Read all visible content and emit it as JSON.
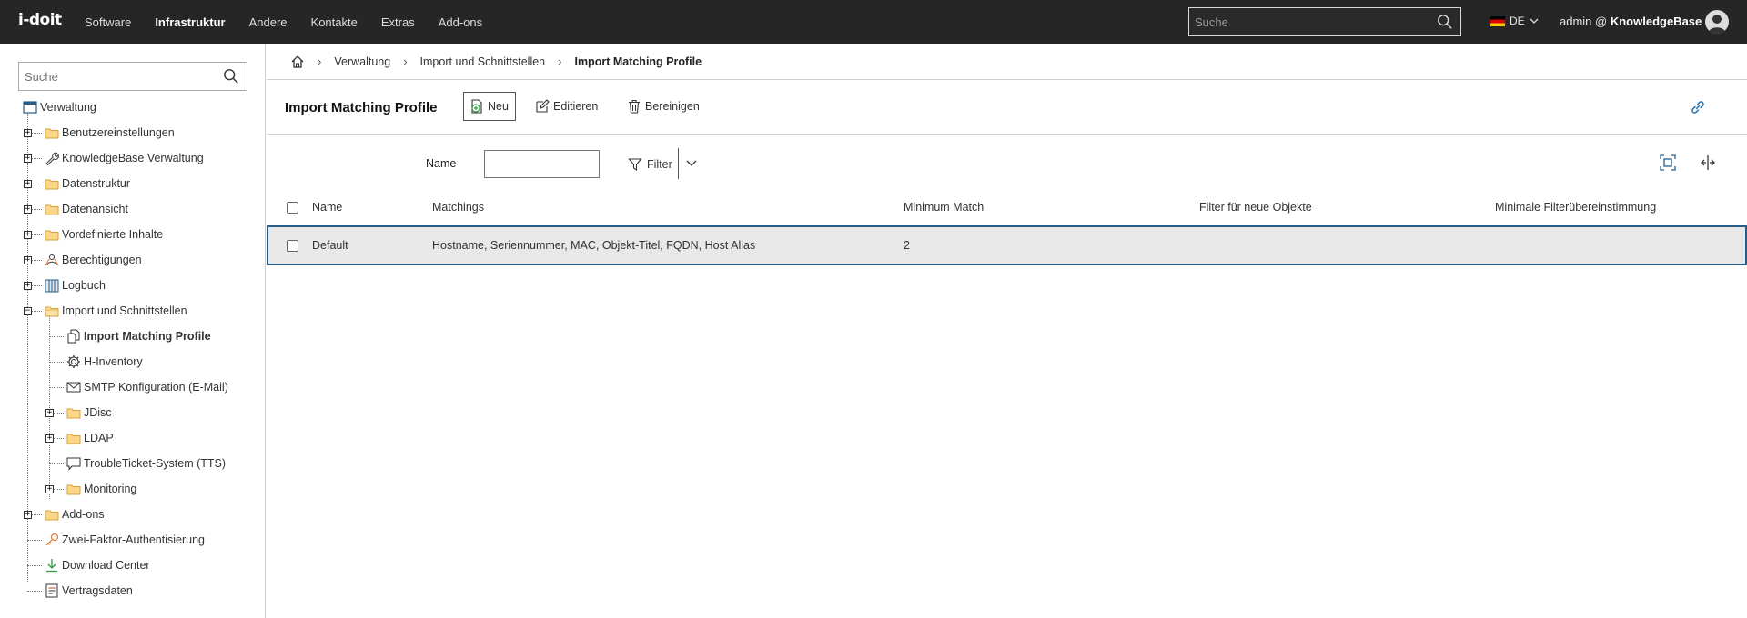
{
  "topbar": {
    "logo": "i-doit",
    "nav": [
      "Software",
      "Infrastruktur",
      "Andere",
      "Kontakte",
      "Extras",
      "Add-ons"
    ],
    "active_nav": "Infrastruktur",
    "search_placeholder": "Suche",
    "language": "DE",
    "user_prefix": "admin @",
    "tenant": "KnowledgeBase"
  },
  "sidebar": {
    "search_placeholder": "Suche",
    "root": "Verwaltung",
    "items": [
      {
        "label": "Benutzereinstellungen",
        "icon": "folder-icon"
      },
      {
        "label": "KnowledgeBase Verwaltung",
        "icon": "wrench-icon"
      },
      {
        "label": "Datenstruktur",
        "icon": "folder-icon"
      },
      {
        "label": "Datenansicht",
        "icon": "folder-icon"
      },
      {
        "label": "Vordefinierte Inhalte",
        "icon": "folder-icon"
      },
      {
        "label": "Berechtigungen",
        "icon": "users-icon"
      },
      {
        "label": "Logbuch",
        "icon": "book-icon"
      },
      {
        "label": "Import und Schnittstellen",
        "icon": "folder-open-icon"
      },
      {
        "label": "Import Matching Profile",
        "icon": "files-icon"
      },
      {
        "label": "H-Inventory",
        "icon": "gear-icon"
      },
      {
        "label": "SMTP Konfiguration (E-Mail)",
        "icon": "mail-icon"
      },
      {
        "label": "JDisc",
        "icon": "folder-icon"
      },
      {
        "label": "LDAP",
        "icon": "folder-icon"
      },
      {
        "label": "TroubleTicket-System (TTS)",
        "icon": "chat-icon"
      },
      {
        "label": "Monitoring",
        "icon": "folder-icon"
      },
      {
        "label": "Add-ons",
        "icon": "folder-icon"
      },
      {
        "label": "Zwei-Faktor-Authentisierung",
        "icon": "key-icon"
      },
      {
        "label": "Download Center",
        "icon": "download-icon"
      },
      {
        "label": "Vertragsdaten",
        "icon": "contract-icon"
      }
    ]
  },
  "breadcrumb": [
    "Verwaltung",
    "Import und Schnittstellen",
    "Import Matching Profile"
  ],
  "header": {
    "title": "Import Matching Profile",
    "new_label": "Neu",
    "edit_label": "Editieren",
    "purge_label": "Bereinigen"
  },
  "filter": {
    "name_label": "Name",
    "name_value": "",
    "filter_label": "Filter"
  },
  "table": {
    "columns": [
      "Name",
      "Matchings",
      "Minimum Match",
      "Filter für neue Objekte",
      "Minimale Filterübereinstimmung"
    ],
    "rows": [
      {
        "name": "Default",
        "matchings": "Hostname, Seriennummer, MAC, Objekt-Titel, FQDN, Host Alias",
        "minimum_match": "2",
        "filter_new": "",
        "min_filter": ""
      }
    ]
  },
  "colors": {
    "topbar_bg": "#262626",
    "selected_row_border": "#2a5d86",
    "selected_row_bg": "#e8e8e8"
  }
}
